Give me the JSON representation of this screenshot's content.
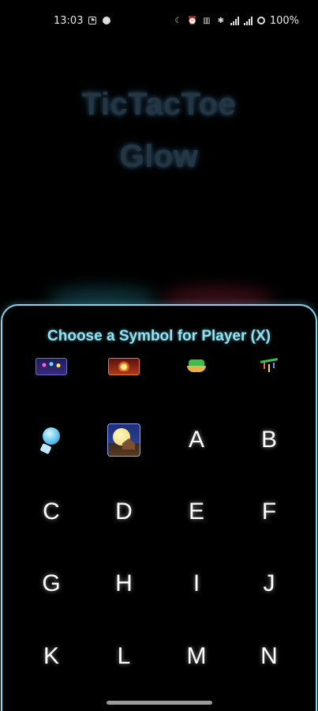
{
  "status_bar": {
    "time": "13:03",
    "battery": "100%"
  },
  "title": {
    "line1": "TicTacToe",
    "line2": "Glow"
  },
  "sheet": {
    "heading": "Choose a Symbol for Player (X)",
    "symbols": [
      {
        "label": "",
        "icon": "fireworks-emoji-icon"
      },
      {
        "label": "",
        "icon": "sparkler-emoji-icon"
      },
      {
        "label": "",
        "icon": "boat-emoji-icon"
      },
      {
        "label": "",
        "icon": "bamboo-decoration-emoji-icon"
      },
      {
        "label": "",
        "icon": "wind-chime-emoji-icon"
      },
      {
        "label": "",
        "icon": "moon-viewing-emoji-icon"
      },
      {
        "label": "A"
      },
      {
        "label": "B"
      },
      {
        "label": "C"
      },
      {
        "label": "D"
      },
      {
        "label": "E"
      },
      {
        "label": "F"
      },
      {
        "label": "G"
      },
      {
        "label": "H"
      },
      {
        "label": "I"
      },
      {
        "label": "J"
      },
      {
        "label": "K"
      },
      {
        "label": "L"
      },
      {
        "label": "M"
      },
      {
        "label": "N"
      }
    ]
  },
  "colors": {
    "accent": "#8fe3f5",
    "sheet_border": "#7fd6ee",
    "title": "#243644"
  }
}
